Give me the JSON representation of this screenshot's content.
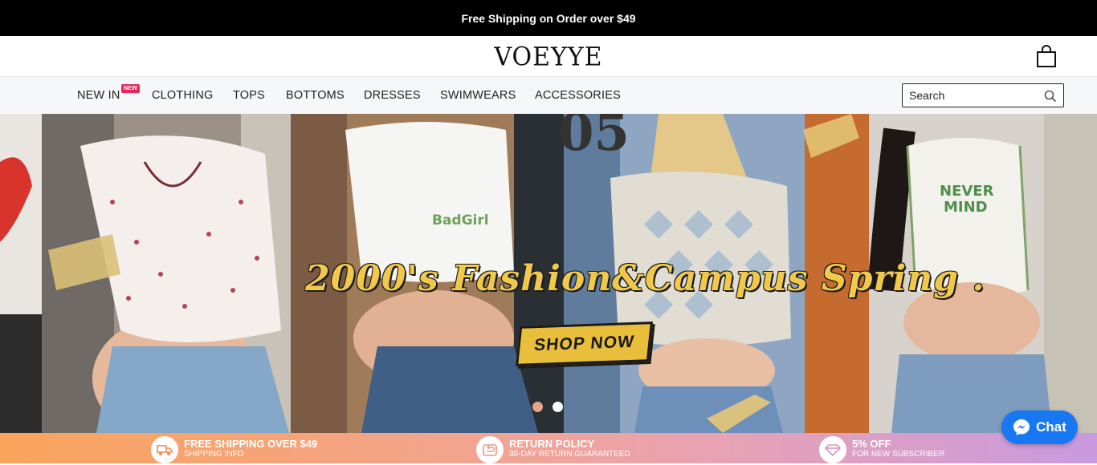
{
  "announcement": "Free Shipping on Order over $49",
  "brand": "VOEYYE",
  "nav": {
    "items": [
      {
        "label": "NEW IN",
        "badge": "NEW"
      },
      {
        "label": "CLOTHING"
      },
      {
        "label": "TOPS"
      },
      {
        "label": "BOTTOMS"
      },
      {
        "label": "DRESSES"
      },
      {
        "label": "SWIMWEARS"
      },
      {
        "label": "ACCESSORIES"
      }
    ],
    "search_placeholder": "Search"
  },
  "hero": {
    "headline": "2000's Fashion&Campus Spring .",
    "cta": "SHOP NOW",
    "slide_count": 2,
    "active_slide": 2,
    "shirt_prints": {
      "badgirl": "BadGirl",
      "nevermind_1": "NEVER",
      "nevermind_2": "MIND"
    }
  },
  "features": [
    {
      "title": "FREE SHIPPING OVER $49",
      "subtitle": "SHIPPING INFO",
      "icon": "truck-icon"
    },
    {
      "title": "RETURN POLICY",
      "subtitle": "30-DAY RETURN GUARANTEED",
      "icon": "return-icon"
    },
    {
      "title": "5% OFF",
      "subtitle": "FOR NEW SUBSCRIBER",
      "icon": "diamond-icon"
    }
  ],
  "chat": {
    "label": "Chat",
    "icon": "messenger-icon"
  },
  "colors": {
    "accent": "#e9be3a",
    "chat": "#1877f2",
    "badge": "#e8265b"
  }
}
